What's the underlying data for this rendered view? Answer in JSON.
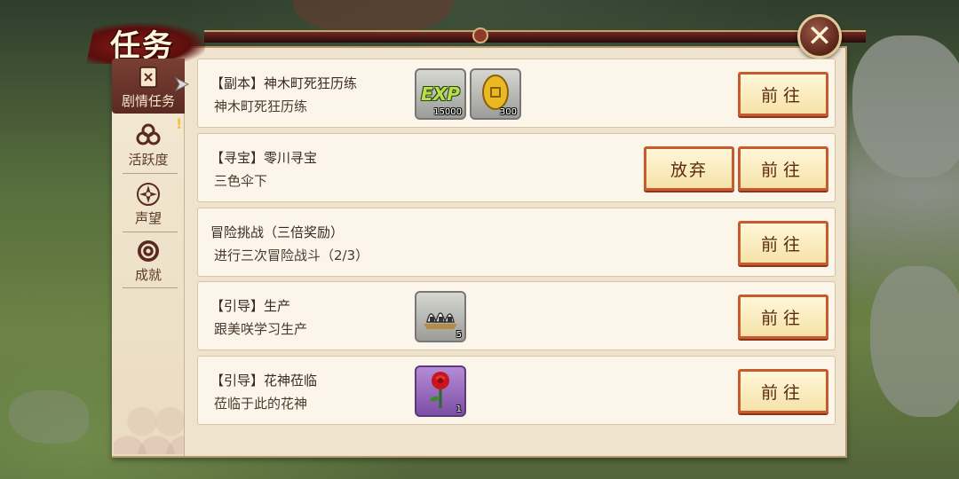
{
  "header": {
    "title": "任务",
    "close_label": "✕"
  },
  "sidebar": {
    "items": [
      {
        "label": "剧情任务",
        "icon": "scroll-icon",
        "active": true
      },
      {
        "label": "活跃度",
        "icon": "flower-icon",
        "active": false
      },
      {
        "label": "声望",
        "icon": "shuriken-icon",
        "active": false
      },
      {
        "label": "成就",
        "icon": "badge-icon",
        "active": false
      }
    ],
    "notice_mark": "!"
  },
  "tasks": [
    {
      "title": "【副本】神木町死狂历练",
      "desc": "神木町死狂历练",
      "rewards": [
        {
          "icon": "exp-icon",
          "text": "EXP",
          "count": "15000"
        },
        {
          "icon": "gold-coin-icon",
          "count": "300"
        }
      ],
      "buttons": [
        "前往"
      ]
    },
    {
      "title": "【寻宝】零川寻宝",
      "desc": "三色伞下",
      "rewards": [],
      "buttons": [
        "放弃",
        "前往"
      ]
    },
    {
      "title": "冒险挑战（三倍奖励）",
      "desc": "进行三次冒险战斗（2/3）",
      "rewards": [],
      "buttons": [
        "前往"
      ]
    },
    {
      "title": "【引导】生产",
      "desc": "跟美咲学习生产",
      "rewards": [
        {
          "icon": "rice-ball-icon",
          "count": "5"
        }
      ],
      "buttons": [
        "前往"
      ]
    },
    {
      "title": "【引导】花神莅临",
      "desc": "莅临于此的花神",
      "rewards": [
        {
          "icon": "rose-icon",
          "count": "1"
        }
      ],
      "buttons": [
        "前往"
      ]
    }
  ],
  "colors": {
    "button_border": "#c85b2e",
    "panel_bg": "#efe3cd",
    "sidebar_active": "#7a3f34"
  }
}
